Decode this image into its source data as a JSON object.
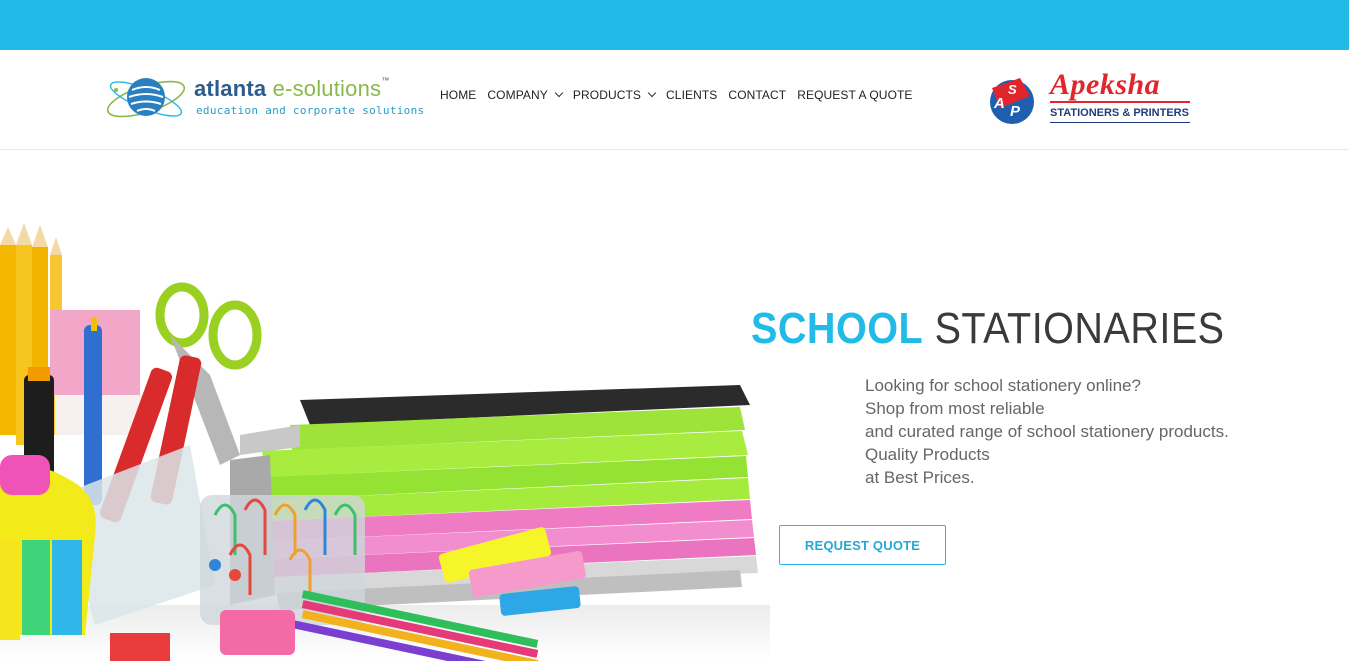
{
  "colors": {
    "accent": "#22bbe8",
    "brand_blue": "#2c5c8e",
    "brand_green": "#8ab84a",
    "apeksha_red": "#e0262c",
    "apeksha_navy": "#1f3d7a"
  },
  "header": {
    "logo_left": {
      "brand_main": "atlanta",
      "brand_sub": "e-solutions",
      "trademark": "™",
      "tagline": "education and corporate solutions",
      "icon": "globe-orbit-icon"
    },
    "nav": [
      {
        "label": "HOME",
        "has_dropdown": false
      },
      {
        "label": "COMPANY",
        "has_dropdown": true
      },
      {
        "label": "PRODUCTS",
        "has_dropdown": true
      },
      {
        "label": "CLIENTS",
        "has_dropdown": false
      },
      {
        "label": "CONTACT",
        "has_dropdown": false
      },
      {
        "label": "REQUEST A QUOTE",
        "has_dropdown": false
      }
    ],
    "logo_right": {
      "name": "Apeksha",
      "subtitle": "STATIONERS & PRINTERS",
      "emblem_text": "SAP",
      "icon": "sap-emblem-icon"
    }
  },
  "hero": {
    "title_highlight": "SCHOOL",
    "title_rest": "STATIONARIES",
    "description_lines": [
      "Looking for school stationery online?",
      "Shop from most reliable",
      "and curated range of school stationery products.",
      "Quality Products",
      "at Best Prices."
    ],
    "cta_label": "REQUEST QUOTE",
    "image": "stationery-pile-image"
  }
}
